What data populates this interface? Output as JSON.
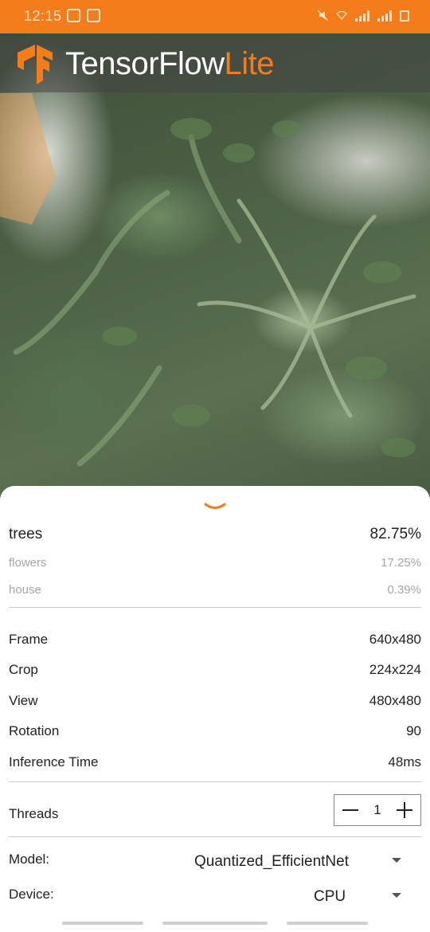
{
  "status_bar": {
    "time": "12:15",
    "left_icons": [
      "mail-icon",
      "image-icon"
    ],
    "right_icons": [
      "mute-icon",
      "wifi-icon",
      "signal-icon",
      "signal-icon",
      "battery-icon"
    ],
    "color": "#f57c1a"
  },
  "header": {
    "brand_primary": "TensorFlow",
    "brand_accent": "Lite",
    "logo_icon": "tensorflow-logo-icon",
    "accent_color": "#f57c1a"
  },
  "results": [
    {
      "label": "trees",
      "score": "82.75%"
    },
    {
      "label": "flowers",
      "score": "17.25%"
    },
    {
      "label": "house",
      "score": "0.39%"
    }
  ],
  "info": [
    {
      "label": "Frame",
      "value": "640x480"
    },
    {
      "label": "Crop",
      "value": "224x224"
    },
    {
      "label": "View",
      "value": "480x480"
    },
    {
      "label": "Rotation",
      "value": "90"
    },
    {
      "label": "Inference Time",
      "value": "48ms"
    }
  ],
  "threads": {
    "label": "Threads",
    "value": "1"
  },
  "model": {
    "label": "Model:",
    "value": "Quantized_EfficientNet"
  },
  "device": {
    "label": "Device:",
    "value": "CPU"
  }
}
